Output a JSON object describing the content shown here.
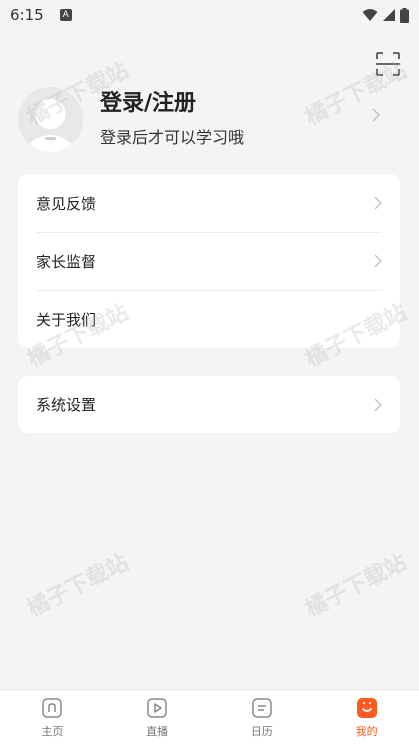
{
  "status_bar": {
    "time": "6:15",
    "a_icon": "A"
  },
  "profile": {
    "title": "登录/注册",
    "subtitle": "登录后才可以学习哦"
  },
  "menu_group_1": [
    {
      "label": "意见反馈"
    },
    {
      "label": "家长监督"
    },
    {
      "label": "关于我们"
    }
  ],
  "menu_group_2": [
    {
      "label": "系统设置"
    }
  ],
  "watermark": "橘子下载站",
  "tabs": [
    {
      "label": "主页",
      "icon": "home-icon",
      "active": false
    },
    {
      "label": "直播",
      "icon": "play-icon",
      "active": false
    },
    {
      "label": "日历",
      "icon": "calendar-icon",
      "active": false
    },
    {
      "label": "我的",
      "icon": "profile-icon",
      "active": true
    }
  ],
  "colors": {
    "accent": "#ff5a1f",
    "background": "#f4f4f4"
  }
}
